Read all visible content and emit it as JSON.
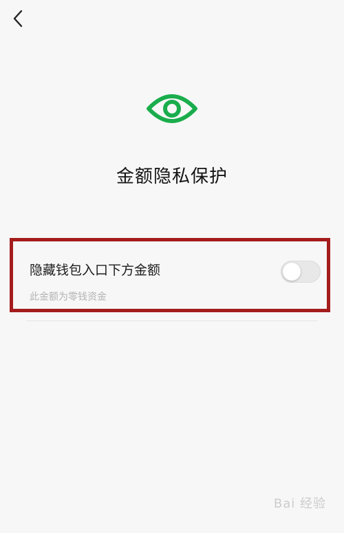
{
  "header": {
    "back_icon": "chevron-left-icon"
  },
  "hero": {
    "icon": "eye-icon",
    "icon_color": "#1aad4c",
    "title": "金额隐私保护"
  },
  "setting": {
    "label": "隐藏钱包入口下方金额",
    "description": "此金额为零钱资金",
    "toggle_on": false,
    "highlight_color": "#a41c1c"
  },
  "watermark": {
    "text": "Bai 经验"
  }
}
